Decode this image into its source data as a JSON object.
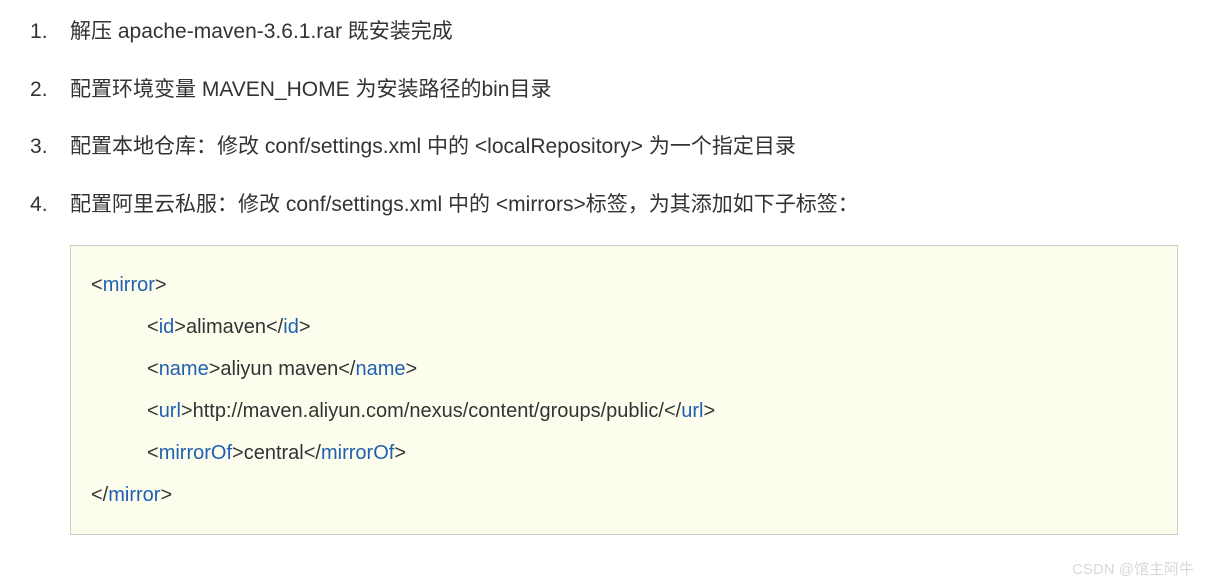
{
  "list": {
    "items": [
      "解压 apache-maven-3.6.1.rar 既安装完成",
      "配置环境变量 MAVEN_HOME 为安装路径的bin目录",
      "配置本地仓库：修改 conf/settings.xml 中的 <localRepository> 为一个指定目录",
      "配置阿里云私服：修改 conf/settings.xml 中的 <mirrors>标签，为其添加如下子标签："
    ]
  },
  "code": {
    "lines": [
      {
        "indent": 0,
        "parts": [
          {
            "cls": "bracket",
            "text": "<"
          },
          {
            "cls": "tag",
            "text": "mirror"
          },
          {
            "cls": "bracket",
            "text": ">"
          }
        ]
      },
      {
        "indent": 1,
        "parts": [
          {
            "cls": "bracket",
            "text": "<"
          },
          {
            "cls": "tag",
            "text": "id"
          },
          {
            "cls": "bracket",
            "text": ">"
          },
          {
            "cls": "",
            "text": "alimaven"
          },
          {
            "cls": "bracket",
            "text": "</"
          },
          {
            "cls": "tag",
            "text": "id"
          },
          {
            "cls": "bracket",
            "text": ">"
          }
        ]
      },
      {
        "indent": 1,
        "parts": [
          {
            "cls": "bracket",
            "text": "<"
          },
          {
            "cls": "tag",
            "text": "name"
          },
          {
            "cls": "bracket",
            "text": ">"
          },
          {
            "cls": "",
            "text": "aliyun maven"
          },
          {
            "cls": "bracket",
            "text": "</"
          },
          {
            "cls": "tag",
            "text": "name"
          },
          {
            "cls": "bracket",
            "text": ">"
          }
        ]
      },
      {
        "indent": 1,
        "parts": [
          {
            "cls": "bracket",
            "text": "<"
          },
          {
            "cls": "tag",
            "text": "url"
          },
          {
            "cls": "bracket",
            "text": ">"
          },
          {
            "cls": "",
            "text": "http://maven.aliyun.com/nexus/content/groups/public/"
          },
          {
            "cls": "bracket",
            "text": "</"
          },
          {
            "cls": "tag",
            "text": "url"
          },
          {
            "cls": "bracket",
            "text": ">"
          }
        ]
      },
      {
        "indent": 1,
        "parts": [
          {
            "cls": "bracket",
            "text": "<"
          },
          {
            "cls": "tag",
            "text": "mirrorOf"
          },
          {
            "cls": "bracket",
            "text": ">"
          },
          {
            "cls": "",
            "text": "central"
          },
          {
            "cls": "bracket",
            "text": "</"
          },
          {
            "cls": "tag",
            "text": "mirrorOf"
          },
          {
            "cls": "bracket",
            "text": ">"
          }
        ]
      },
      {
        "indent": 0,
        "parts": [
          {
            "cls": "bracket",
            "text": "</"
          },
          {
            "cls": "tag",
            "text": "mirror"
          },
          {
            "cls": "bracket",
            "text": ">"
          }
        ]
      }
    ]
  },
  "watermark": "CSDN @馆主阿牛"
}
